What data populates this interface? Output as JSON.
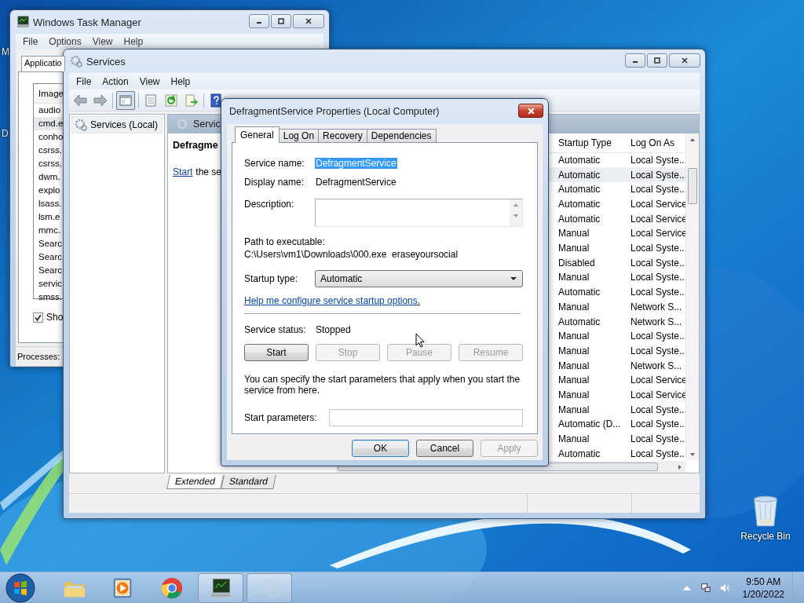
{
  "desktop": {
    "cut_icon_labels": [
      "M",
      "D"
    ],
    "recycle_bin": "Recycle Bin"
  },
  "task_manager": {
    "title": "Windows Task Manager",
    "menu": [
      "File",
      "Options",
      "View",
      "Help"
    ],
    "tabs": [
      {
        "label": "Applicatio",
        "selected": true
      }
    ],
    "column": "Image",
    "processes": [
      {
        "name": "audio",
        "selected": false
      },
      {
        "name": "cmd.e",
        "selected": true
      },
      {
        "name": "conho",
        "selected": false
      },
      {
        "name": "csrss.",
        "selected": false
      },
      {
        "name": "csrss.",
        "selected": false
      },
      {
        "name": "dwm.",
        "selected": false
      },
      {
        "name": "explo",
        "selected": false
      },
      {
        "name": "lsass.",
        "selected": false
      },
      {
        "name": "lsm.e",
        "selected": false
      },
      {
        "name": "mmc.",
        "selected": false
      },
      {
        "name": "Searc",
        "selected": false
      },
      {
        "name": "Searc",
        "selected": false
      },
      {
        "name": "Searc",
        "selected": false
      },
      {
        "name": "servic",
        "selected": false
      },
      {
        "name": "smss.",
        "selected": false
      }
    ],
    "show_all": {
      "label": "Sho",
      "checked": true
    },
    "status": "Processes:"
  },
  "services": {
    "title": "Services",
    "menu": [
      "File",
      "Action",
      "View",
      "Help"
    ],
    "tree": [
      {
        "label": "Services (Local)",
        "selected": true
      }
    ],
    "panel_header": "Servic",
    "description_title": "Defragme",
    "start_link": "Start",
    "start_rest": "the se",
    "columns": [
      "Startup Type",
      "Log On As"
    ],
    "rows": [
      {
        "startup_type": "Automatic",
        "log_on_as": "Local Syste...",
        "selected": false
      },
      {
        "startup_type": "Automatic",
        "log_on_as": "Local Syste...",
        "selected": true
      },
      {
        "startup_type": "Automatic",
        "log_on_as": "Local Syste...",
        "selected": false
      },
      {
        "startup_type": "Automatic",
        "log_on_as": "Local Service",
        "selected": false
      },
      {
        "startup_type": "Automatic",
        "log_on_as": "Local Service",
        "selected": false
      },
      {
        "startup_type": "Manual",
        "log_on_as": "Local Service",
        "selected": false
      },
      {
        "startup_type": "Manual",
        "log_on_as": "Local Syste...",
        "selected": false
      },
      {
        "startup_type": "Disabled",
        "log_on_as": "Local Syste...",
        "selected": false
      },
      {
        "startup_type": "Manual",
        "log_on_as": "Local Syste...",
        "selected": false
      },
      {
        "startup_type": "Automatic",
        "log_on_as": "Local Syste...",
        "selected": false
      },
      {
        "startup_type": "Manual",
        "log_on_as": "Network S...",
        "selected": false
      },
      {
        "startup_type": "Automatic",
        "log_on_as": "Network S...",
        "selected": false
      },
      {
        "startup_type": "Manual",
        "log_on_as": "Local Syste...",
        "selected": false
      },
      {
        "startup_type": "Manual",
        "log_on_as": "Local Syste...",
        "selected": false
      },
      {
        "startup_type": "Manual",
        "log_on_as": "Network S...",
        "selected": false
      },
      {
        "startup_type": "Manual",
        "log_on_as": "Local Service",
        "selected": false
      },
      {
        "startup_type": "Manual",
        "log_on_as": "Local Service",
        "selected": false
      },
      {
        "startup_type": "Manual",
        "log_on_as": "Local Syste...",
        "selected": false
      },
      {
        "startup_type": "Automatic (D...",
        "log_on_as": "Local Syste...",
        "selected": false
      },
      {
        "startup_type": "Manual",
        "log_on_as": "Local Syste...",
        "selected": false
      },
      {
        "startup_type": "Automatic",
        "log_on_as": "Local Syste...",
        "selected": false
      }
    ],
    "view_tabs": [
      {
        "label": "Extended",
        "selected": true
      },
      {
        "label": "Standard",
        "selected": false
      }
    ]
  },
  "dialog": {
    "title": "DefragmentService Properties (Local Computer)",
    "tabs": [
      {
        "label": "General",
        "selected": true
      },
      {
        "label": "Log On",
        "selected": false
      },
      {
        "label": "Recovery",
        "selected": false
      },
      {
        "label": "Dependencies",
        "selected": false
      }
    ],
    "service_name_label": "Service name:",
    "service_name": {
      "value": "DefragmentService",
      "selected": true
    },
    "display_name_label": "Display name:",
    "display_name": "DefragmentService",
    "description_label": "Description:",
    "path_label": "Path to executable:",
    "path": "C:\\Users\\vm1\\Downloads\\000.exe  eraseyoursocial",
    "startup_type_label": "Startup type:",
    "startup_type": "Automatic",
    "help_link": "Help me configure service startup options.",
    "status_label": "Service status:",
    "status": "Stopped",
    "control_buttons": [
      {
        "label": "Start",
        "disabled": false
      },
      {
        "label": "Stop",
        "disabled": true
      },
      {
        "label": "Pause",
        "disabled": true
      },
      {
        "label": "Resume",
        "disabled": true
      }
    ],
    "params_note": "You can specify the start parameters that apply when you start the service from here.",
    "params_label": "Start parameters:",
    "buttons": [
      {
        "label": "OK",
        "disabled": false,
        "default": true
      },
      {
        "label": "Cancel",
        "disabled": false,
        "default": false
      },
      {
        "label": "Apply",
        "disabled": true,
        "default": false
      }
    ]
  },
  "taskbar": {
    "apps": [
      {
        "kind": "folder",
        "running": false
      },
      {
        "kind": "media",
        "running": false
      },
      {
        "kind": "browser",
        "running": false
      },
      {
        "kind": "monitor",
        "running": true
      },
      {
        "kind": "gears",
        "running": true
      }
    ],
    "time": "9:50 AM",
    "date": "1/20/2022"
  }
}
